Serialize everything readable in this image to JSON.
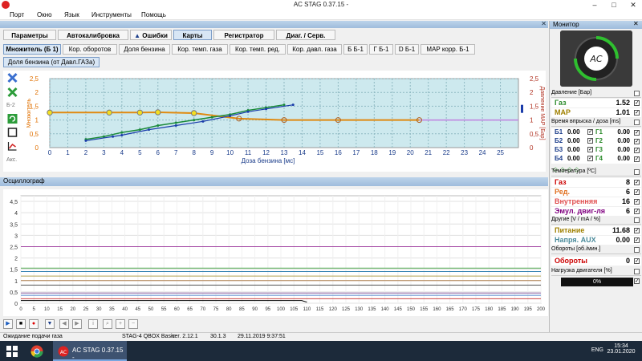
{
  "window": {
    "title": "AC STAG 0.37.15 -",
    "min": "–",
    "max": "□",
    "close": "✕"
  },
  "menu": [
    "Порт",
    "Окно",
    "Язык",
    "Инструменты",
    "Помощь"
  ],
  "tabs": [
    {
      "label": "Параметры",
      "active": false
    },
    {
      "label": "Автокалибровка",
      "active": false
    },
    {
      "label": "Ошибки",
      "active": false
    },
    {
      "label": "Карты",
      "active": true
    },
    {
      "label": "Регистратор",
      "active": false
    },
    {
      "label": "Диаг. / Серв.",
      "active": false
    }
  ],
  "subtabs": [
    {
      "label": "Множитель (Б 1)",
      "active": true
    },
    {
      "label": "Кор. оборотов",
      "active": false
    },
    {
      "label": "Доля бензина",
      "active": false
    },
    {
      "label": "Кор. темп. газа",
      "active": false
    },
    {
      "label": "Кор. темп. ред.",
      "active": false
    },
    {
      "label": "Кор. давл. газа",
      "active": false
    },
    {
      "label": "Б Б-1",
      "active": false
    },
    {
      "label": "Г Б-1",
      "active": false
    },
    {
      "label": "D Б-1",
      "active": false
    },
    {
      "label": "MAP корр. Б-1",
      "active": false
    }
  ],
  "subsubtab": "Доля бензина (от Давл.ГАЗа)",
  "side_tools": {
    "b2": "Б-2",
    "acc": "Акс."
  },
  "map_chart": {
    "xlabel": "Доза бензина [мс]",
    "ylabel_left": "Множитель",
    "ylabel_right": "Давление MAP [Бар]",
    "x_ticks": [
      0,
      1,
      2,
      3,
      4,
      5,
      6,
      7,
      8,
      9,
      10,
      11,
      12,
      13,
      14,
      15,
      16,
      17,
      18,
      19,
      20,
      21,
      22,
      23,
      24,
      25
    ],
    "y_ticks": [
      "0",
      "0,5",
      "1",
      "1,5",
      "2",
      "2,5"
    ],
    "xlim": [
      0,
      26
    ],
    "ylim": [
      0,
      2.5
    ],
    "multiplier_line": [
      [
        0,
        1.27
      ],
      [
        3.3,
        1.27
      ],
      [
        5,
        1.27
      ],
      [
        6,
        1.28
      ],
      [
        8,
        1.25
      ],
      [
        10.5,
        1.05
      ],
      [
        13,
        1.0
      ],
      [
        16,
        1.0
      ],
      [
        20.5,
        1.0
      ]
    ],
    "map_line": [
      [
        13,
        1.0
      ],
      [
        26,
        1.0
      ]
    ],
    "green_points": [
      [
        2,
        0.3
      ],
      [
        3,
        0.4
      ],
      [
        4,
        0.55
      ],
      [
        5,
        0.65
      ],
      [
        6,
        0.8
      ],
      [
        7,
        0.9
      ],
      [
        8,
        1.0
      ],
      [
        9,
        1.1
      ],
      [
        10,
        1.2
      ],
      [
        11,
        1.35
      ],
      [
        12,
        1.45
      ],
      [
        13,
        1.55
      ]
    ],
    "blue_points": [
      [
        2,
        0.25
      ],
      [
        3.5,
        0.4
      ],
      [
        4,
        0.45
      ],
      [
        5.5,
        0.65
      ],
      [
        7,
        0.8
      ],
      [
        8.5,
        0.95
      ],
      [
        10,
        1.15
      ],
      [
        11,
        1.3
      ],
      [
        12,
        1.4
      ],
      [
        13.5,
        1.55
      ]
    ],
    "markers_yellow": [
      [
        0,
        1.27
      ],
      [
        3.3,
        1.27
      ],
      [
        5,
        1.27
      ],
      [
        6,
        1.28
      ],
      [
        8,
        1.25
      ]
    ],
    "markers_open": [
      [
        10.5,
        1.05
      ],
      [
        13,
        1.0
      ],
      [
        16,
        1.0
      ],
      [
        20.5,
        1.0
      ]
    ]
  },
  "osc": {
    "title": "Осциллограф",
    "y_ticks": [
      "0",
      "0,5",
      "1",
      "1,5",
      "2",
      "2,5",
      "3",
      "3,5",
      "4",
      "4,5"
    ],
    "x_ticks": [
      "0",
      "5",
      "10",
      "15",
      "20",
      "25",
      "30",
      "35",
      "40",
      "45",
      "50",
      "55",
      "60",
      "65",
      "70",
      "75",
      "80",
      "85",
      "90",
      "95",
      "100",
      "105",
      "110",
      "115",
      "120",
      "125",
      "130",
      "135",
      "140",
      "145",
      "150",
      "155",
      "160",
      "165",
      "170",
      "175",
      "180",
      "185",
      "190",
      "195",
      "200"
    ],
    "xlim": [
      0,
      200
    ],
    "ylim": [
      0,
      4.75
    ],
    "lines": [
      {
        "color": "#a040a0",
        "y": 2.5
      },
      {
        "color": "#55aa55",
        "y": 1.55
      },
      {
        "color": "#3080b0",
        "y": 1.4
      },
      {
        "color": "#b0a050",
        "y": 1.2
      },
      {
        "color": "#b08050",
        "y": 1.0
      },
      {
        "color": "#555555",
        "y": 0.8
      },
      {
        "color": "#8a5ea0",
        "y": 0.45
      },
      {
        "color": "#5588cc",
        "y": 0.35
      },
      {
        "color": "#cc4444",
        "y": 0.2
      }
    ]
  },
  "status": {
    "left": "Ожидание подачи газа",
    "device": "STAG-4 QBOX Basic",
    "version": "ver. 2.12.1",
    "fw": "30.1.3",
    "datetime": "29.11.2019 9:37:51"
  },
  "monitor": {
    "title": "Монитор",
    "pressure_title": "Давление [Бар]",
    "gas_label": "Газ",
    "gas_value": "1.52",
    "map_label": "MAP",
    "map_value": "1.01",
    "inj_title": "Время впрыска / доза [ms]",
    "inj": [
      {
        "b": "Б1",
        "bv": "0.00",
        "g": "Г1",
        "gv": "0.00"
      },
      {
        "b": "Б2",
        "bv": "0.00",
        "g": "Г2",
        "gv": "0.00"
      },
      {
        "b": "Б3",
        "bv": "0.00",
        "g": "Г3",
        "gv": "0.00"
      },
      {
        "b": "Б4",
        "bv": "0.00",
        "g": "Г4",
        "gv": "0.00"
      }
    ],
    "temp_title": "Температура [ºC]",
    "temps": [
      {
        "label": "Газ",
        "value": "8",
        "color": "#cc0000"
      },
      {
        "label": "Ред.",
        "value": "6",
        "color": "#e07020"
      },
      {
        "label": "Внутренняя",
        "value": "16",
        "color": "#e05050"
      },
      {
        "label": "Эмул. двиг-ля",
        "value": "6",
        "color": "#800080"
      }
    ],
    "other_title": "Другие [V / mA / %]",
    "power_label": "Питание",
    "power_value": "11.68",
    "aux_label": "Напря. AUX",
    "aux_value": "0.00",
    "rpm_title": "Обороты [об./мин.]",
    "rpm_label": "Обороты",
    "rpm_value": "0",
    "load_title": "Нагрузка двигателя [%]",
    "load_value": "0%"
  },
  "taskbar": {
    "app": "AC STAG 0.37.15 -",
    "lang": "ENG",
    "time": "15:34",
    "date": "23.01.2020"
  }
}
